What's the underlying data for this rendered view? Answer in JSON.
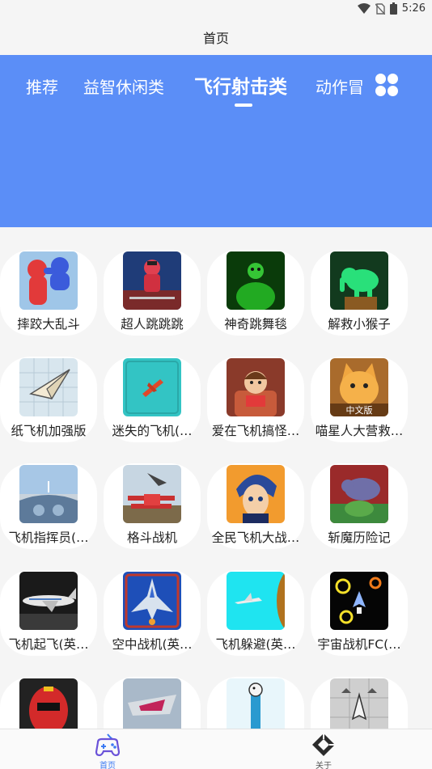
{
  "status": {
    "time": "5:26",
    "icons": [
      "wifi-icon",
      "no-sim-icon",
      "battery-icon"
    ]
  },
  "page_title": "首页",
  "tabs": [
    {
      "label": "推荐",
      "active": false
    },
    {
      "label": "益智休闲类",
      "active": false
    },
    {
      "label": "飞行射击类",
      "active": true
    },
    {
      "label": "动作冒",
      "active": false
    }
  ],
  "colors": {
    "accent": "#5b8ef7",
    "nav_active": "#3d7bf3",
    "background": "#f5f5f5"
  },
  "games": [
    {
      "name": "摔跤大乱斗",
      "icon": "wrestling-thumb"
    },
    {
      "name": "超人跳跳跳",
      "icon": "superhero-thumb"
    },
    {
      "name": "神奇跳舞毯",
      "icon": "green-creature-thumb"
    },
    {
      "name": "解救小猴子",
      "icon": "elephant-thumb"
    },
    {
      "name": "纸飞机加强版",
      "icon": "paper-plane-thumb"
    },
    {
      "name": "迷失的飞机(…",
      "icon": "red-plane-thumb"
    },
    {
      "name": "爱在飞机搞怪…",
      "icon": "boy-seat-thumb"
    },
    {
      "name": "喵星人大营救…",
      "icon": "cat-thumb"
    },
    {
      "name": "飞机指挥员(…",
      "icon": "cockpit-thumb"
    },
    {
      "name": "格斗战机",
      "icon": "biplane-thumb"
    },
    {
      "name": "全民飞机大战…",
      "icon": "anime-pilot-thumb"
    },
    {
      "name": "斩魔历险记",
      "icon": "monster-thumb"
    },
    {
      "name": "飞机起飞(英…",
      "icon": "airliner-thumb"
    },
    {
      "name": "空中战机(英…",
      "icon": "jet-fighter-thumb"
    },
    {
      "name": "飞机躲避(英…",
      "icon": "cyan-plane-thumb"
    },
    {
      "name": "宇宙战机FC(…",
      "icon": "space-shooter-thumb"
    },
    {
      "name": "",
      "icon": "ranger-thumb"
    },
    {
      "name": "",
      "icon": "racing-jet-thumb"
    },
    {
      "name": "",
      "icon": "bird-tower-thumb"
    },
    {
      "name": "",
      "icon": "fighter-grid-thumb"
    }
  ],
  "bottom_nav": [
    {
      "label": "首页",
      "icon": "gamepad-icon",
      "active": true
    },
    {
      "label": "关于",
      "icon": "diamond-logo-icon",
      "active": false
    }
  ]
}
